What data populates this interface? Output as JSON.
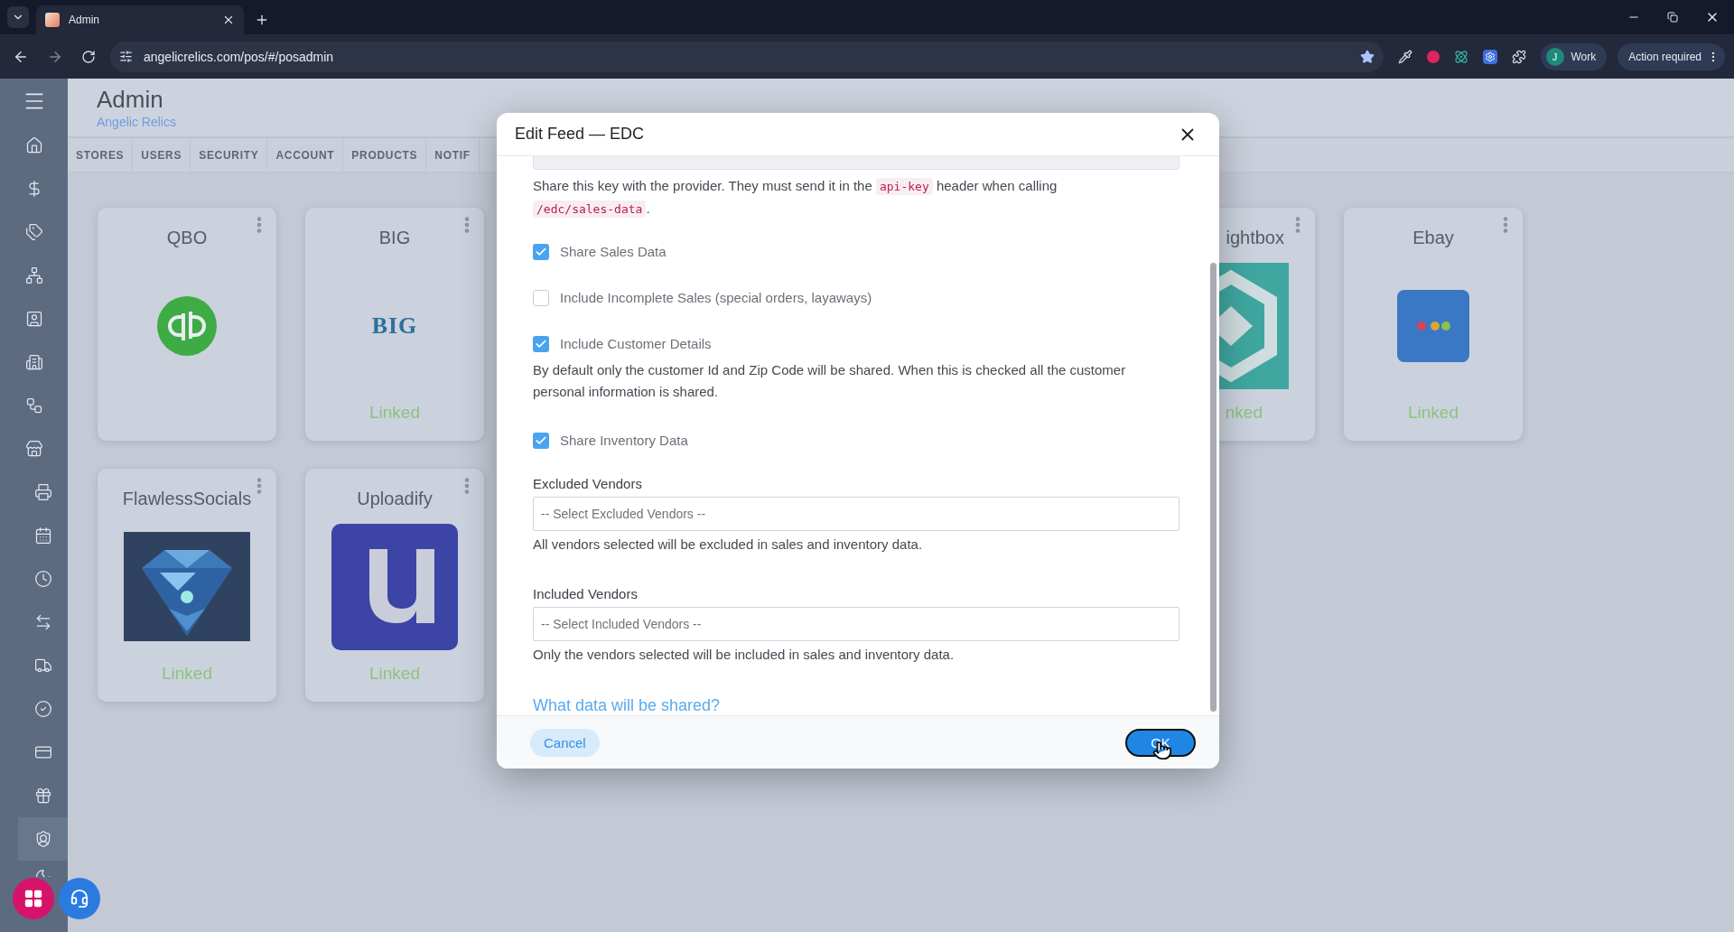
{
  "browser": {
    "tab_title": "Admin",
    "url": "angelicrelics.com/pos/#/posadmin",
    "profile_initial": "J",
    "profile_label": "Work",
    "action_label": "Action required"
  },
  "sidebar": {
    "items": [
      {
        "kind": "menu",
        "selected": false
      },
      {
        "kind": "main",
        "selected": false
      },
      {
        "kind": "main",
        "selected": false
      },
      {
        "kind": "main",
        "selected": false
      },
      {
        "kind": "main",
        "selected": false
      },
      {
        "kind": "main",
        "selected": false
      },
      {
        "kind": "main",
        "selected": false
      },
      {
        "kind": "main",
        "selected": false
      },
      {
        "kind": "main",
        "selected": false
      },
      {
        "kind": "sub",
        "selected": false
      },
      {
        "kind": "sub",
        "selected": false
      },
      {
        "kind": "sub",
        "selected": false
      },
      {
        "kind": "sub",
        "selected": false
      },
      {
        "kind": "sub",
        "selected": false
      },
      {
        "kind": "sub",
        "selected": false
      },
      {
        "kind": "sub",
        "selected": false
      },
      {
        "kind": "sub",
        "selected": false
      },
      {
        "kind": "sub",
        "selected": true
      },
      {
        "kind": "sub",
        "selected": false
      }
    ]
  },
  "header": {
    "title": "Admin",
    "subtitle": "Angelic Relics"
  },
  "tabs": [
    "STORES",
    "USERS",
    "SECURITY",
    "ACCOUNT",
    "PRODUCTS",
    "NOTIF"
  ],
  "card_rows": [
    [
      {
        "kind": "qb",
        "title": "QBO"
      },
      {
        "kind": "big",
        "title": "BIG",
        "logo_text": "BIG",
        "status": "Linked"
      },
      {
        "kind": "hexagon",
        "title": "ightbox",
        "status": "nked"
      },
      {
        "kind": "ebay",
        "title": "Ebay",
        "status": "Linked"
      }
    ],
    [
      {
        "kind": "picture",
        "title": "FlawlessSocials",
        "status": "Linked"
      },
      {
        "kind": "u",
        "title": "Uploadify",
        "status": "Linked"
      }
    ]
  ],
  "dialog": {
    "title": "Edit Feed — EDC",
    "key_note": [
      {
        "text": "Share this key with the provider. They must send it in the "
      },
      {
        "code": "api-key"
      },
      {
        "text": " header when calling "
      },
      {
        "code": "/edc/sales-data"
      },
      {
        "text": "."
      }
    ],
    "options": [
      {
        "label": "Share Sales Data",
        "checked": true
      },
      {
        "label": "Include Incomplete Sales (special orders, layaways)",
        "checked": false
      },
      {
        "label": "Include Customer Details",
        "checked": true,
        "description": "By default only the customer Id and Zip Code will be shared. When this is checked all the customer personal information is shared."
      },
      {
        "label": "Share Inventory Data",
        "checked": true
      }
    ],
    "selects": [
      {
        "label": "Excluded Vendors",
        "placeholder": "-- Select Excluded Vendors --",
        "helper": "All vendors selected will be excluded in sales and inventory data."
      },
      {
        "label": "Included Vendors",
        "placeholder": "-- Select Included Vendors --",
        "helper": "Only the vendors selected will be included in sales and inventory data."
      }
    ],
    "link": "What data will be shared?",
    "cancel": "Cancel",
    "ok": {
      "label": "OK",
      "focused": true
    }
  }
}
